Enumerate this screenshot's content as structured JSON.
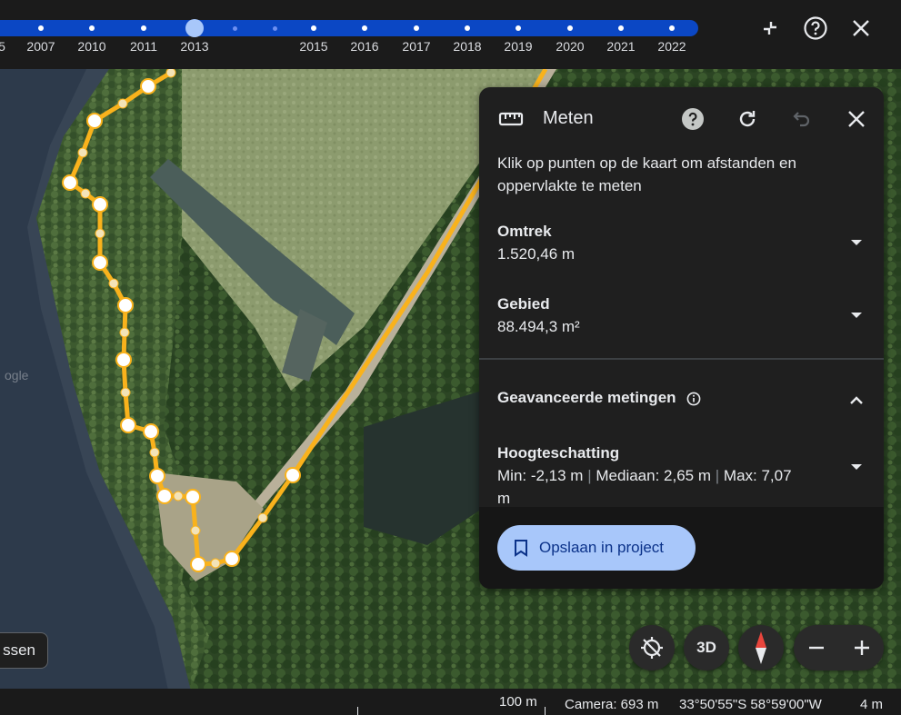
{
  "timeline": {
    "years": [
      "2007",
      "2010",
      "2011",
      "2013",
      "2015",
      "2016",
      "2017",
      "2018",
      "2019",
      "2020",
      "2021",
      "2022"
    ],
    "partial_left_label": "5",
    "selected_year": "2013"
  },
  "top_controls": {
    "collapse_icon": "collapse-icon",
    "help_icon": "help-icon",
    "close_icon": "close-icon"
  },
  "panel": {
    "title": "Meten",
    "intro": "Klik op punten op de kaart om afstanden en oppervlakte te meten",
    "perimeter": {
      "label": "Omtrek",
      "value": "1.520,46 m"
    },
    "area": {
      "label": "Gebied",
      "value": "88.494,3 m²"
    },
    "advanced_label": "Geavanceerde metingen",
    "elevation": {
      "label": "Hoogteschatting",
      "min": "Min: -2,13 m",
      "median": "Mediaan: 2,65 m",
      "max": "Max: 7,07 m",
      "separator": "|"
    },
    "save_button": "Opslaan in project"
  },
  "map_controls": {
    "three_d_label": "3D",
    "zoom_out_icon": "minus-icon",
    "zoom_in_icon": "plus-icon"
  },
  "left_button_label": "ssen",
  "watermark": "ogle",
  "status": {
    "scale": "100 m",
    "camera": "Camera: 693 m",
    "coordinates": "33°50'55\"S 58°59'00\"W",
    "elevation": "4 m"
  },
  "colors": {
    "accent_blue": "#0b47c4",
    "selected_year": "#a8c7fa",
    "measure_line": "#f9b21c",
    "panel_bg": "#1f1f1f"
  }
}
